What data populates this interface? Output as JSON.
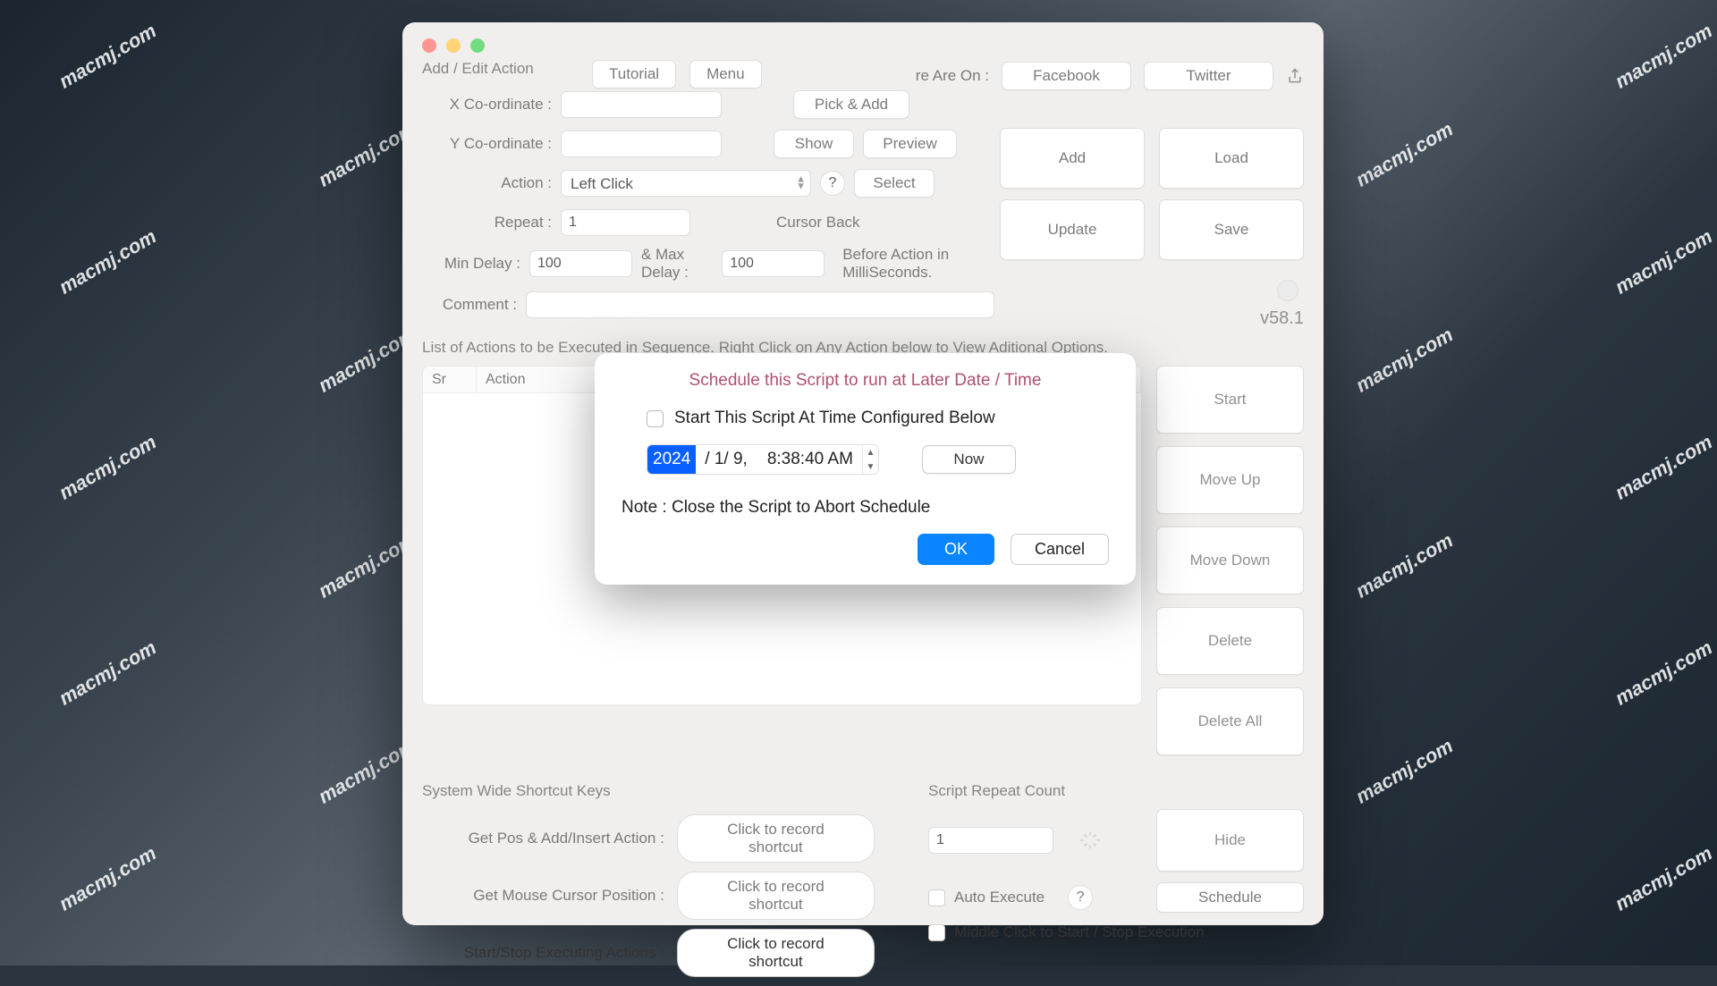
{
  "watermark_text": "macmj.com",
  "window": {
    "section_title": "Add / Edit Action",
    "header": {
      "tutorial": "Tutorial",
      "menu": "Menu",
      "are_on": "re Are On :",
      "facebook": "Facebook",
      "twitter": "Twitter"
    },
    "form": {
      "x_label": "X Co-ordinate :",
      "y_label": "Y Co-ordinate :",
      "action_label": "Action :",
      "action_value": "Left Click",
      "repeat_label": "Repeat :",
      "repeat_value": "1",
      "min_delay_label": "Min Delay :",
      "min_delay_value": "100",
      "max_delay_label": "& Max Delay :",
      "max_delay_value": "100",
      "before_action": "Before Action in MilliSeconds.",
      "comment_label": "Comment :",
      "pick_add": "Pick & Add",
      "show": "Show",
      "preview": "Preview",
      "select": "Select",
      "cursor_back": "Cursor Back",
      "add": "Add",
      "load": "Load",
      "update": "Update",
      "save": "Save"
    },
    "version": "v58.1",
    "list_header": "List of Actions to be Executed in Sequence. Right Click on Any Action below to View Aditional Options.",
    "table": {
      "sr": "Sr",
      "action": "Action"
    },
    "side": {
      "start": "Start",
      "move_up": "Move Up",
      "move_down": "Move Down",
      "delete": "Delete",
      "delete_all": "Delete All"
    },
    "shortcuts": {
      "section": "System Wide Shortcut Keys",
      "get_pos": "Get Pos & Add/Insert Action :",
      "get_mouse": "Get Mouse Cursor Position :",
      "start_stop": "Start/Stop Executing Actions :",
      "record": "Click to record shortcut"
    },
    "repeat": {
      "label": "Script Repeat Count",
      "value": "1",
      "auto_execute": "Auto Execute",
      "middle_click": "Middle Click to Start / Stop Execution",
      "hide": "Hide",
      "schedule": "Schedule"
    }
  },
  "modal": {
    "title": "Schedule this Script to run at Later Date / Time",
    "start_label": "Start This Script At Time Configured Below",
    "year": "2024",
    "date_rest": "/ 1/ 9,",
    "time": "8:38:40 AM",
    "now": "Now",
    "note": "Note : Close the Script to Abort Schedule",
    "ok": "OK",
    "cancel": "Cancel"
  }
}
